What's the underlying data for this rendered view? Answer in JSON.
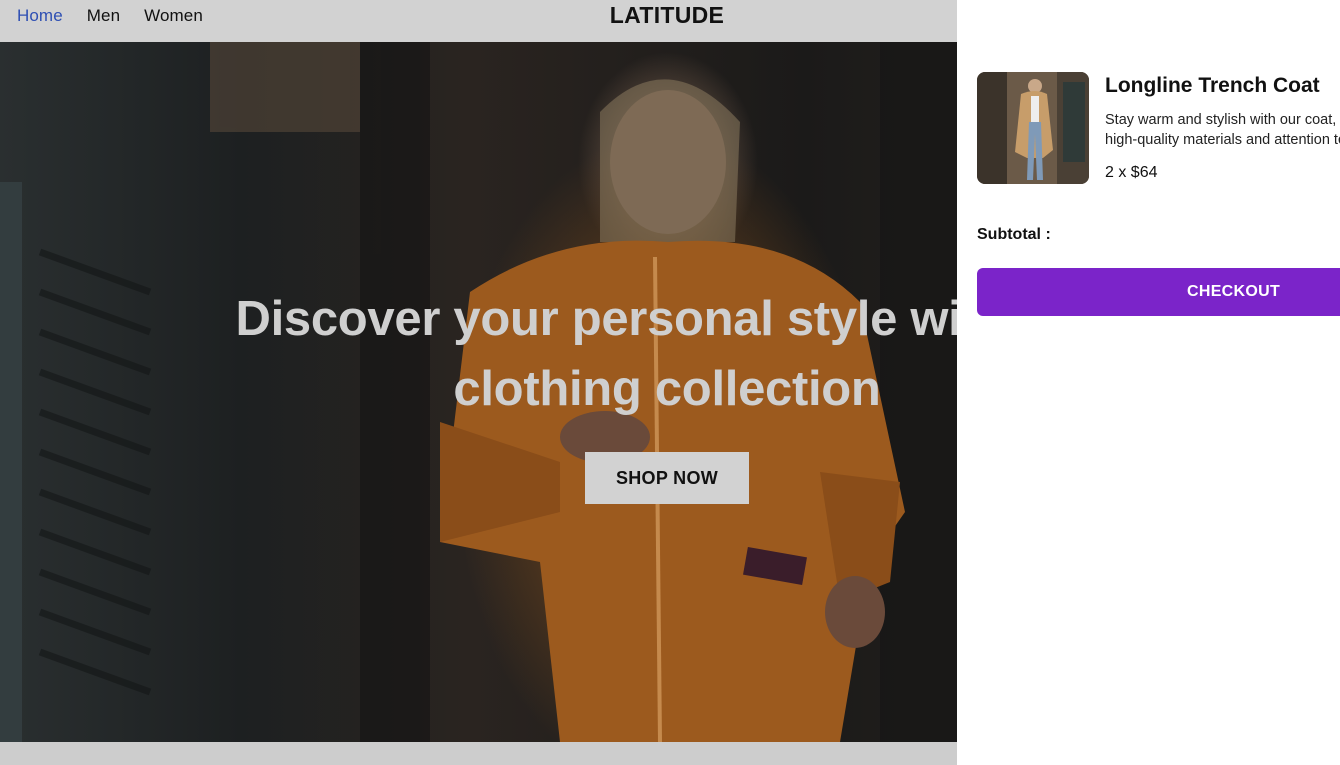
{
  "nav": {
    "links": [
      {
        "label": "Home",
        "active": true
      },
      {
        "label": "Men",
        "active": false
      },
      {
        "label": "Women",
        "active": false
      }
    ],
    "brand": "LATITUDE"
  },
  "hero": {
    "title_line1": "Discover your personal style with our",
    "title_line2": "clothing collection",
    "cta": "SHOP NOW"
  },
  "cart": {
    "items": [
      {
        "name": "Longline Trench Coat",
        "description_line1": "Stay warm and stylish with our coat, made with",
        "description_line2": "high-quality materials and attention to detail",
        "quantity_price": "2 x $64"
      }
    ],
    "subtotal_label": "Subtotal :",
    "checkout_label": "CHECKOUT",
    "accent_color": "#7b24c9"
  },
  "colors": {
    "nav_active": "#2e4fb3",
    "nav_bg": "#d2d2d2",
    "hero_text": "#cfcfcf"
  }
}
